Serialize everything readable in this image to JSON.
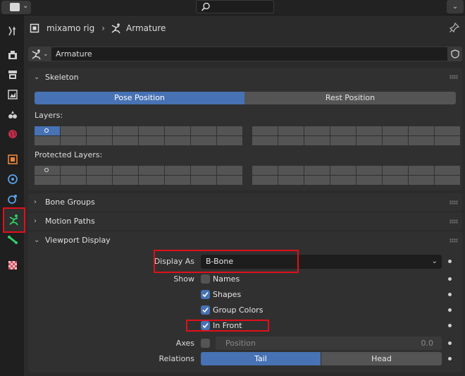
{
  "topbar": {
    "editor_chevron": "⌄",
    "right_chevron": "⌄"
  },
  "breadcrumb": {
    "object": "mixamo rig",
    "separator": "›",
    "data": "Armature"
  },
  "datablock": {
    "name": "Armature"
  },
  "skeleton": {
    "title": "Skeleton",
    "pose_position": "Pose Position",
    "rest_position": "Rest Position",
    "layers_label": "Layers:",
    "protected_layers_label": "Protected Layers:"
  },
  "bone_groups": {
    "title": "Bone Groups"
  },
  "motion_paths": {
    "title": "Motion Paths"
  },
  "viewport_display": {
    "title": "Viewport Display",
    "display_as_label": "Display As",
    "display_as_value": "B-Bone",
    "show_label": "Show",
    "names": "Names",
    "shapes": "Shapes",
    "group_colors": "Group Colors",
    "in_front": "In Front",
    "axes_label": "Axes",
    "position_label": "Position",
    "position_value": "0.0",
    "relations_label": "Relations",
    "tail": "Tail",
    "head": "Head",
    "checks": {
      "names": false,
      "shapes": true,
      "group_colors": true,
      "in_front": true,
      "axes": false
    }
  },
  "colors": {
    "accent": "#4772b3",
    "highlight": "#e0101a",
    "armature_tab": "#2fd16a"
  }
}
